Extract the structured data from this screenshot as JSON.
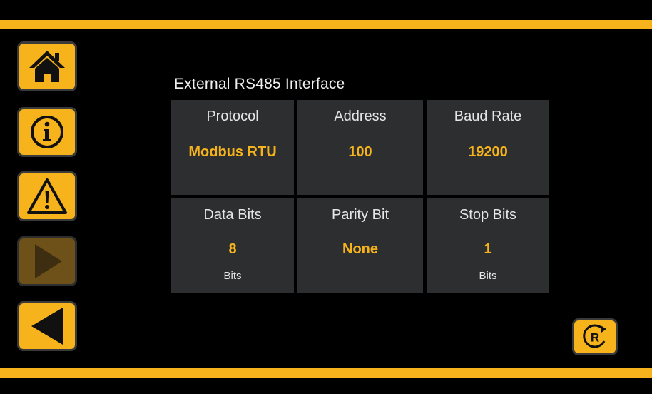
{
  "section_title": "External RS485 Interface",
  "nav": {
    "home_icon": "home-icon",
    "info_icon": "info-icon",
    "warning_icon": "warning-icon",
    "play_icon": "play-icon",
    "back_icon": "back-icon"
  },
  "settings": {
    "protocol": {
      "label": "Protocol",
      "value": "Modbus RTU"
    },
    "address": {
      "label": "Address",
      "value": "100"
    },
    "baud_rate": {
      "label": "Baud Rate",
      "value": "19200"
    },
    "data_bits": {
      "label": "Data Bits",
      "value": "8",
      "unit": "Bits"
    },
    "parity_bit": {
      "label": "Parity Bit",
      "value": "None"
    },
    "stop_bits": {
      "label": "Stop Bits",
      "value": "1",
      "unit": "Bits"
    }
  },
  "reset_button": {
    "glyph": "R"
  },
  "colors": {
    "accent": "#f6b31b",
    "panel": "#2c2e30",
    "background": "#000000",
    "disabled": "#6e5119"
  }
}
